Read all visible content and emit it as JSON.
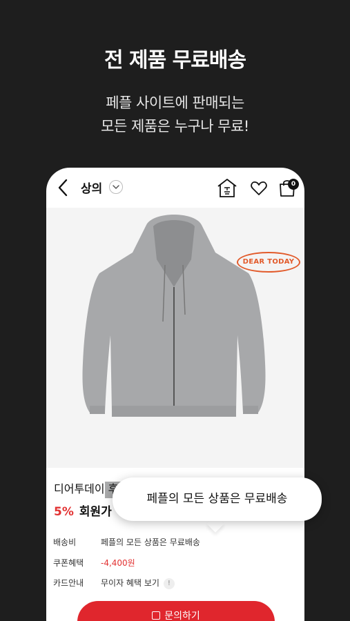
{
  "hero": {
    "title": "전 제품 무료배송",
    "subtitle_line1": "페플 사이트에 판매되는",
    "subtitle_line2": "모든 제품은 누구나 무료!"
  },
  "app": {
    "category_title": "상의",
    "cart_count": "0",
    "brand_stamp": "DEAR TODAY",
    "product_name": "디어투데이 후드",
    "discount": "5%",
    "member_price_label": "회원가 ·",
    "swatches": [
      "#a9aaab",
      "#a3b0a7",
      "#3b3b3d",
      "#0f0f10",
      "#1f4657",
      "#6a2528",
      "#c2a7c0"
    ],
    "info": [
      {
        "key": "배송비",
        "value": "페플의 모든 상품은 무료배송"
      },
      {
        "key": "쿠폰혜택",
        "value": "-4,400원"
      },
      {
        "key": "카드안내",
        "value": "무이자 혜택 보기"
      }
    ],
    "info_badge": "!",
    "inquiry_button": "문의하기"
  },
  "tooltip": {
    "text": "페플의 모든 상품은 무료배송"
  },
  "colors": {
    "background": "#1e1e1e",
    "accent": "#e0262d",
    "discount": "#e23232",
    "stamp": "#e25a2a"
  }
}
